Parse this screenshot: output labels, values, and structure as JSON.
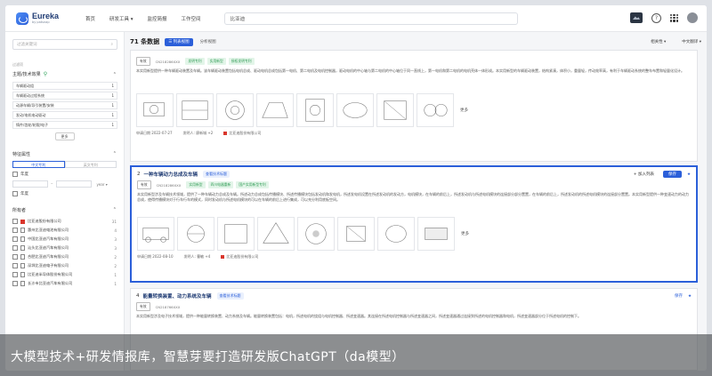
{
  "topbar": {
    "logo_name": "Eureka",
    "logo_sub": "by patsnap",
    "nav": [
      "首页",
      "研发工具 ▾",
      "监控简报",
      "工作空间"
    ],
    "search_value": "比亚迪"
  },
  "sidebar": {
    "filter_placeholder": "过滤关键词",
    "small_label": "过滤项",
    "topic_label": "主题/技术效果",
    "keywords": [
      {
        "label": "车辆驱动组",
        "count": "1"
      },
      {
        "label": "车辆驱动过程系统",
        "count": "1"
      },
      {
        "label": "动源车辆/导引装置/安装",
        "count": "1"
      },
      {
        "label": "发动/电机电动驱动",
        "count": "1"
      },
      {
        "label": "铸件/齿轮/轮毂/电子",
        "count": "1"
      }
    ],
    "more": "更多",
    "feature_label": "特征属性",
    "toggle_on": "中文专利",
    "toggle_off": "英文专利",
    "range1": "年度",
    "unit": "year ▾",
    "range2": "年度",
    "owner_label": "所有者",
    "owners": [
      {
        "name": "比亚迪股份有限公司",
        "count": "31"
      },
      {
        "name": "惠州比亚迪电池有限公司",
        "count": "4"
      },
      {
        "name": "中国比亚迪汽车有限公司",
        "count": "3"
      },
      {
        "name": "汕头比亚迪汽车有限公司",
        "count": "3"
      },
      {
        "name": "合肥比亚迪汽车有限公司",
        "count": "2"
      },
      {
        "name": "深圳比亚迪电子有限公司",
        "count": "2"
      },
      {
        "name": "比亚迪半导体股份有限公司",
        "count": "1"
      },
      {
        "name": "长沙市比亚迪汽车有限公司",
        "count": "1"
      }
    ]
  },
  "main": {
    "result_count": "71 条数据",
    "view_on": "☰ 列表视图",
    "view_off": "分析视图",
    "sort": "相关性 ▾",
    "lang": "中文翻译 ▾",
    "more_images": "更多"
  },
  "cards": [
    {
      "idx": "",
      "title": "",
      "badges": [
        "有效",
        "CN218286XXX"
      ],
      "green_badges": [
        "发明专利",
        "实用新型",
        "授权发明专利"
      ],
      "abstract": "本实用新型提供一种车辆驱动装置及车辆。该车辆驱动装置包括电机总成、驱动电机总成包括第一电机、第二电机及电机控制器，驱动电机的中心轴与第二电机的中心轴位于同一直线上，第一电机和第二电机的电机壳体一体形成。本实用新型的车辆驱动装置，结构紧凑，体积小，重量轻，传动效率高，有利于车辆驱动系统的整车布置和轻量化设计。",
      "date": "申请日期  2022-07-27",
      "inventor": "发明人: 廖新城 +2",
      "owner": "比亚迪股份有限公司",
      "actions": null
    },
    {
      "idx": "2",
      "title": "一种车辆动力总成及车辆",
      "ai_tag": "查看技术标题",
      "badges": [
        "有效",
        "CN218286XXX"
      ],
      "green_badges": [
        "实用新型",
        "四川电器重新",
        "国产实用新型专利"
      ],
      "abstract": "本实用新型涉及车辆技术领域，提供了一种车辆动力总成及车辆。所述动力总成包括传播模块、所述传播模块包括发动机和发电机，所述发电机设置在所述发动机的发动方，电机模块，在车辆的前后上，所述发动机与所述电机模块的连接部分部分置置，在车辆的前后上，所述发动机的所述电机模块的连接部分置置。本实用新型提供一种变速动力的动力总成，使得传播模块对于行车行车的模式，同时发动机与所述电机模块的可以在车辆的前后上进行集成，可以充分利用底板空间。",
      "date": "申请日期  2022-08-10",
      "inventor": "发明人: 曹敏 +4",
      "owner": "比亚迪股份有限公司",
      "actions": {
        "add": "+ 加入列表",
        "save": "保存",
        "star": "★"
      }
    },
    {
      "idx": "4",
      "title": "能量转换装置、动力系统及车辆",
      "ai_tag": "查看技术标题",
      "badges": [
        "有效",
        "CN218766XXX"
      ],
      "green_badges": [],
      "abstract": "本实用新型涉及电子技术领域，提供一种能量转换装置、动力系统及车辆。能量转换装置包括：电机，所述电机的绕组与电机控制器、所述变速器。其连接在所述电机控制器与所述变速器之间，所述变速器通过连接到所述的电机控制器和电机，所述变速器部分位于所述电机的控制下。",
      "date": "",
      "inventor": "",
      "owner": "",
      "actions": {
        "save": "保存",
        "star": "★"
      }
    }
  ],
  "caption": "大模型技术+研发情报库，智慧芽要打造研发版ChatGPT（da模型）"
}
